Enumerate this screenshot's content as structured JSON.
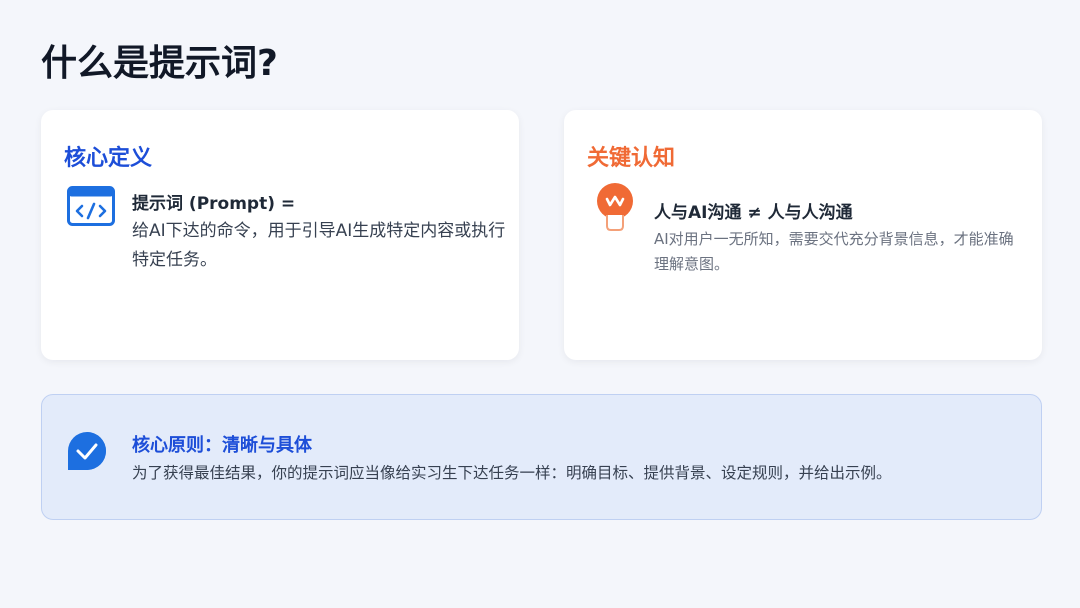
{
  "page": {
    "title": "什么是提示词?"
  },
  "colors": {
    "background": "#f4f6fb",
    "accent_blue": "#1d4ed8",
    "accent_orange": "#f06a35",
    "principle_bg": "#e3ebfa"
  },
  "definition_card": {
    "heading": "核心定义",
    "icon": "code-window-icon",
    "title": "提示词 (Prompt) =",
    "text": "给AI下达的命令，用于引导AI生成特定内容或执行特定任务。"
  },
  "insight_card": {
    "heading": "关键认知",
    "icon": "lightbulb-icon",
    "title": "人与AI沟通 ≠ 人与人沟通",
    "text": "AI对用户一无所知，需要交代充分背景信息，才能准确理解意图。"
  },
  "principle": {
    "icon": "check-badge-icon",
    "title": "核心原则：清晰与具体",
    "text": "为了获得最佳结果，你的提示词应当像给实习生下达任务一样：明确目标、提供背景、设定规则，并给出示例。"
  }
}
